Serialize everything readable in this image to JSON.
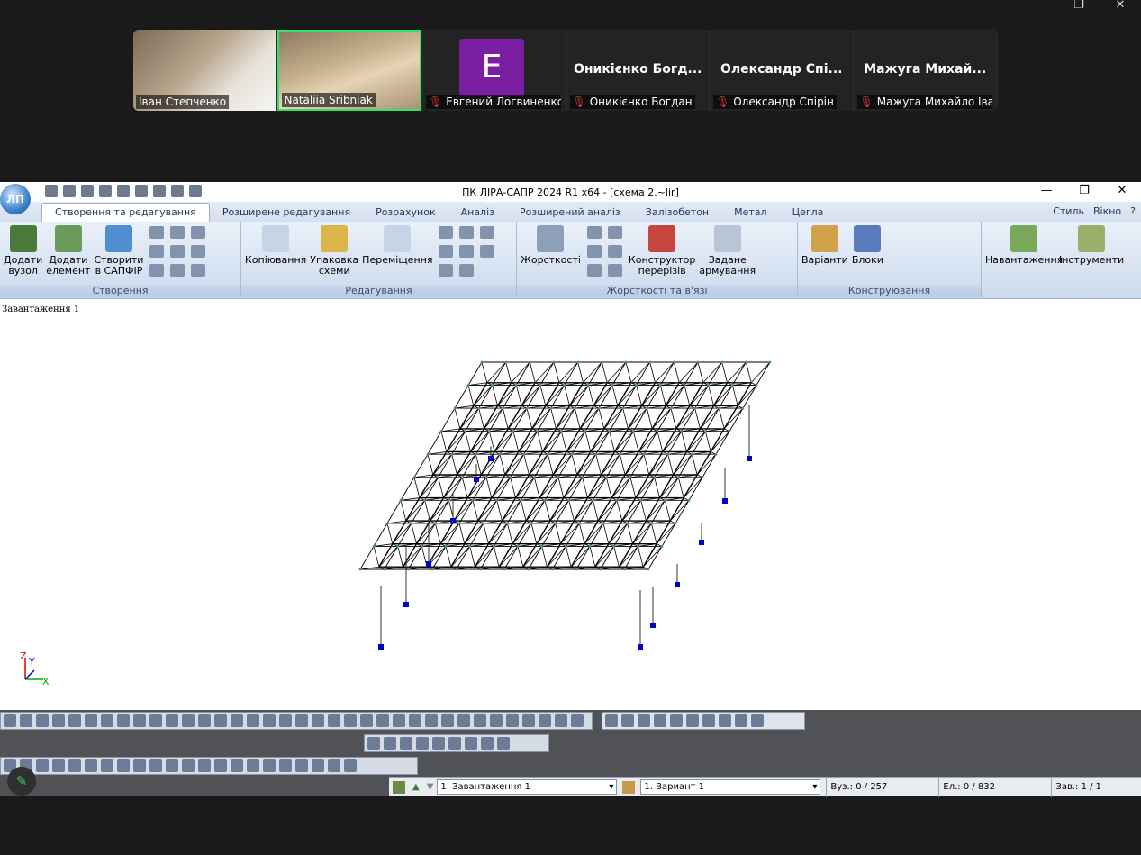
{
  "meeting": {
    "participants": [
      {
        "name": "Іван Степченко"
      },
      {
        "name": "Nataliia Sribniak"
      },
      {
        "name": "Евгений Логвиненко",
        "avatar_letter": "E",
        "avatar_color": "#7b1fa2"
      },
      {
        "name": "Оникієнко Богдан",
        "big": "Оникієнко Богд..."
      },
      {
        "name": "Олександр Спірін",
        "big": "Олександр Спі..."
      },
      {
        "name": "Мажуга Михайло Іва...",
        "big": "Мажуга Михай..."
      }
    ]
  },
  "app": {
    "title": "ПК ЛІРА-САПР  2024 R1 x64 - [схема 2.~lir]",
    "tabs": [
      "Створення та редагування",
      "Розширене редагування",
      "Розрахунок",
      "Аналіз",
      "Розширений аналіз",
      "Залізобетон",
      "Метал",
      "Цегла"
    ],
    "tab_right": [
      "Стиль",
      "Вікно"
    ],
    "ribbon": {
      "g1": {
        "title": "Створення",
        "b1": "Додати\nвузол",
        "b2": "Додати\nелемент",
        "b3": "Створити\nв САПФІР"
      },
      "g2": {
        "title": "Редагування",
        "b1": "Копіювання",
        "b2": "Упаковка\nсхеми",
        "b3": "Переміщення"
      },
      "g3": {
        "title": "Жорсткості та в'язі",
        "b1": "Жорсткості",
        "b2": "Конструктор\nперерізів",
        "b3": "Задане\nармування"
      },
      "g4": {
        "title": "Конструювання",
        "b1": "Варіанти",
        "b2": "Блоки"
      },
      "g5": {
        "b1": "Навантаження"
      },
      "g6": {
        "b1": "Інструменти"
      }
    },
    "canvas_label": "Завантаження 1",
    "status": {
      "load_case": "1. Завантаження 1",
      "variant": "1. Вариант 1",
      "nodes": "Вуз.: 0 / 257",
      "elements": "Ел.: 0 / 832",
      "loads": "Зав.: 1 / 1"
    }
  },
  "colors": {
    "node": "#0000cc",
    "mesh": "#000000",
    "joint": "#3aa83a",
    "active_border": "#2ee26a"
  }
}
